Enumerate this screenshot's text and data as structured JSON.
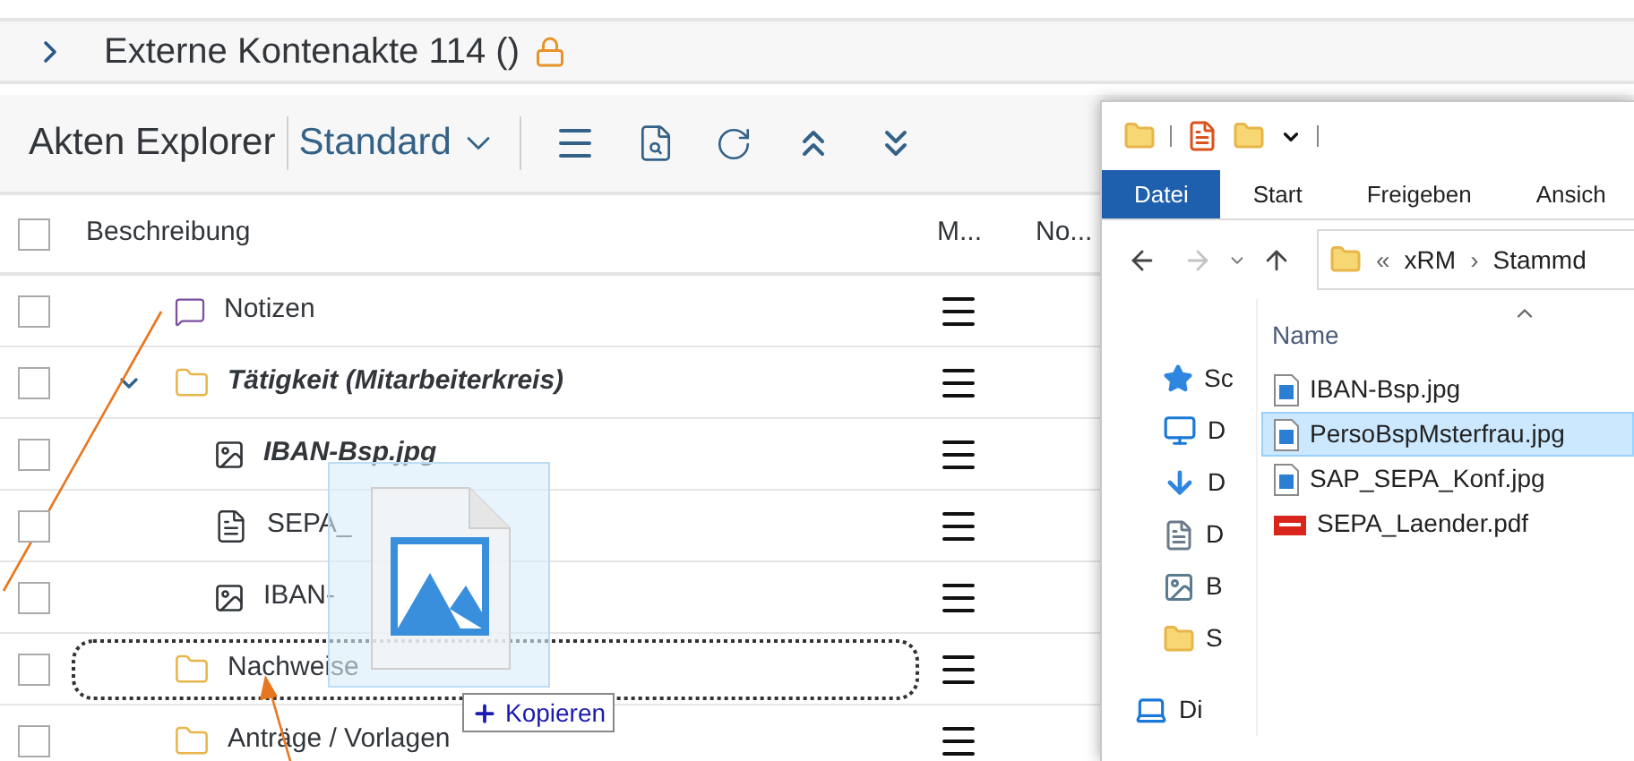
{
  "header": {
    "title": "Externe Kontenakte 114 ()",
    "locked": true
  },
  "toolbar": {
    "title": "Akten Explorer",
    "variant": "Standard"
  },
  "table": {
    "all_checked": false,
    "columns": [
      "Beschreibung",
      "M...",
      "No..."
    ],
    "rows": [
      {
        "label": "Notizen",
        "kind": "note",
        "checked": false,
        "emphasized": false,
        "drop_target": false
      },
      {
        "label": "Tätigkeit (Mitarbeiterkreis)",
        "kind": "folder",
        "checked": false,
        "emphasized": true,
        "drop_target": false,
        "expanded": true,
        "children": [
          {
            "label": "IBAN-Bsp.jpg",
            "kind": "image",
            "checked": false,
            "emphasized": true,
            "drop_target": false
          },
          {
            "label": "SEPA_",
            "kind": "pdf",
            "checked": false,
            "emphasized": false,
            "drop_target": false
          },
          {
            "label": "IBAN-",
            "kind": "image",
            "checked": false,
            "emphasized": false,
            "drop_target": false
          }
        ]
      },
      {
        "label": "Nachweise",
        "kind": "folder",
        "checked": false,
        "emphasized": false,
        "drop_target": true
      },
      {
        "label": "Anträge / Vorlagen",
        "kind": "folder",
        "checked": false,
        "emphasized": false,
        "drop_target": false
      }
    ]
  },
  "drag": {
    "action": "Kopieren"
  },
  "explorer": {
    "ribbon_tabs": [
      {
        "label": "Datei",
        "selected": true
      },
      {
        "label": "Start",
        "selected": false
      },
      {
        "label": "Freigeben",
        "selected": false
      },
      {
        "label": "Ansich",
        "selected": false
      }
    ],
    "address": {
      "overflow": "«",
      "parts": [
        "xRM",
        "Stammd"
      ],
      "separator": "›"
    },
    "nav_items": [
      {
        "label": "Sc",
        "kind": "star"
      },
      {
        "label": "D",
        "kind": "desktop"
      },
      {
        "label": "D",
        "kind": "download"
      },
      {
        "label": "D",
        "kind": "document"
      },
      {
        "label": "B",
        "kind": "picture"
      },
      {
        "label": "S",
        "kind": "folder"
      },
      {
        "label": "Di",
        "kind": "pc"
      }
    ],
    "column": "Name",
    "files": [
      {
        "name": "IBAN-Bsp.jpg",
        "kind": "image",
        "selected": false
      },
      {
        "name": "PersoBspMsterfrau.jpg",
        "kind": "image",
        "selected": true
      },
      {
        "name": "SAP_SEPA_Konf.jpg",
        "kind": "image",
        "selected": false
      },
      {
        "name": "SEPA_Laender.pdf",
        "kind": "pdf",
        "selected": false
      }
    ]
  }
}
